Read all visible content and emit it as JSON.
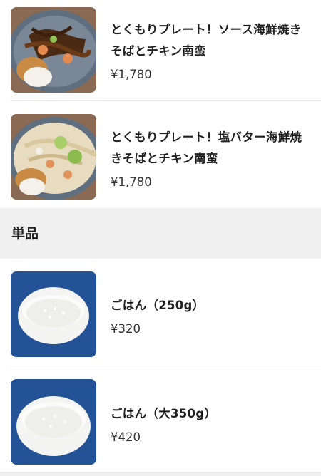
{
  "items_top": [
    {
      "name": "とくもりプレート！ソース海鮮焼きそばとチキン南蛮",
      "price": "¥1,780",
      "image": "yakisoba-sauce-plate"
    },
    {
      "name": "とくもりプレート！塩バター海鮮焼きそばとチキン南蛮",
      "price": "¥1,780",
      "image": "yakisoba-salt-butter-plate"
    }
  ],
  "section": {
    "title": "単品"
  },
  "items_bottom": [
    {
      "name": "ごはん（250g）",
      "price": "¥320",
      "image": "rice-bowl"
    },
    {
      "name": "ごはん（大350g）",
      "price": "¥420",
      "image": "rice-bowl-large"
    }
  ]
}
